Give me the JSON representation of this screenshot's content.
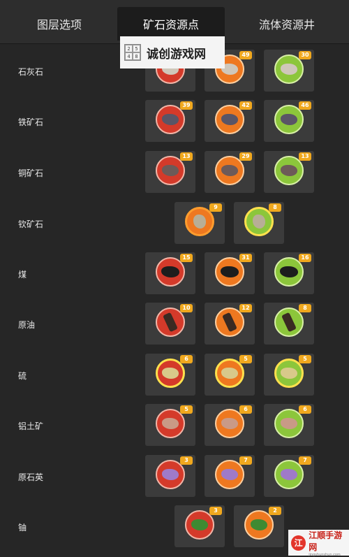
{
  "tabs": [
    {
      "label": "图层选项",
      "active": false
    },
    {
      "label": "矿石资源点",
      "active": true
    },
    {
      "label": "流体资源井",
      "active": false
    }
  ],
  "watermark": {
    "logo_cells": [
      "2",
      "5",
      "4",
      "8"
    ],
    "text": "诚创游戏网"
  },
  "rows": [
    {
      "label": "石灰石",
      "icon": "limestone-icon",
      "tiles": [
        {
          "color": "red",
          "count": ""
        },
        {
          "color": "orange",
          "count": "49"
        },
        {
          "color": "green",
          "count": "30"
        }
      ]
    },
    {
      "label": "铁矿石",
      "icon": "iron-ore-icon",
      "tiles": [
        {
          "color": "red",
          "count": "39"
        },
        {
          "color": "orange",
          "count": "42"
        },
        {
          "color": "green",
          "count": "46"
        }
      ]
    },
    {
      "label": "铜矿石",
      "icon": "copper-ore-icon",
      "tiles": [
        {
          "color": "red",
          "count": "13"
        },
        {
          "color": "orange",
          "count": "29"
        },
        {
          "color": "green",
          "count": "13"
        }
      ]
    },
    {
      "label": "钦矿石",
      "icon": "caterium-ore-icon",
      "tiles": [
        {
          "color": "orange",
          "count": "9"
        },
        {
          "color": "green",
          "count": "8"
        }
      ]
    },
    {
      "label": "煤",
      "icon": "coal-icon",
      "tiles": [
        {
          "color": "red",
          "count": "15"
        },
        {
          "color": "orange",
          "count": "31"
        },
        {
          "color": "green",
          "count": "16"
        }
      ]
    },
    {
      "label": "原油",
      "icon": "crude-oil-icon",
      "tiles": [
        {
          "color": "red",
          "count": "10"
        },
        {
          "color": "orange",
          "count": "12"
        },
        {
          "color": "green",
          "count": "8"
        }
      ]
    },
    {
      "label": "硫",
      "icon": "sulfur-icon",
      "tiles": [
        {
          "color": "red",
          "count": "6"
        },
        {
          "color": "orange",
          "count": "5"
        },
        {
          "color": "green",
          "count": "5"
        }
      ]
    },
    {
      "label": "铝土矿",
      "icon": "bauxite-icon",
      "tiles": [
        {
          "color": "red",
          "count": "5"
        },
        {
          "color": "orange",
          "count": "6"
        },
        {
          "color": "green",
          "count": "6"
        }
      ]
    },
    {
      "label": "原石英",
      "icon": "raw-quartz-icon",
      "tiles": [
        {
          "color": "red",
          "count": "3"
        },
        {
          "color": "orange",
          "count": "7"
        },
        {
          "color": "green",
          "count": "7"
        }
      ]
    },
    {
      "label": "铀",
      "icon": "uranium-icon",
      "tiles": [
        {
          "color": "red",
          "count": "3"
        },
        {
          "color": "orange",
          "count": "2"
        }
      ]
    }
  ],
  "corner_logo": {
    "glyph": "江",
    "name": "江顺手游网",
    "url": "jingshunshun.com"
  },
  "colors": {
    "background": "#262626",
    "tile": "#3b3b3b",
    "badge": "#f0a81e",
    "purity_impure": "#d43a2a",
    "purity_normal": "#ee7820",
    "purity_pure": "#8cc63b"
  }
}
